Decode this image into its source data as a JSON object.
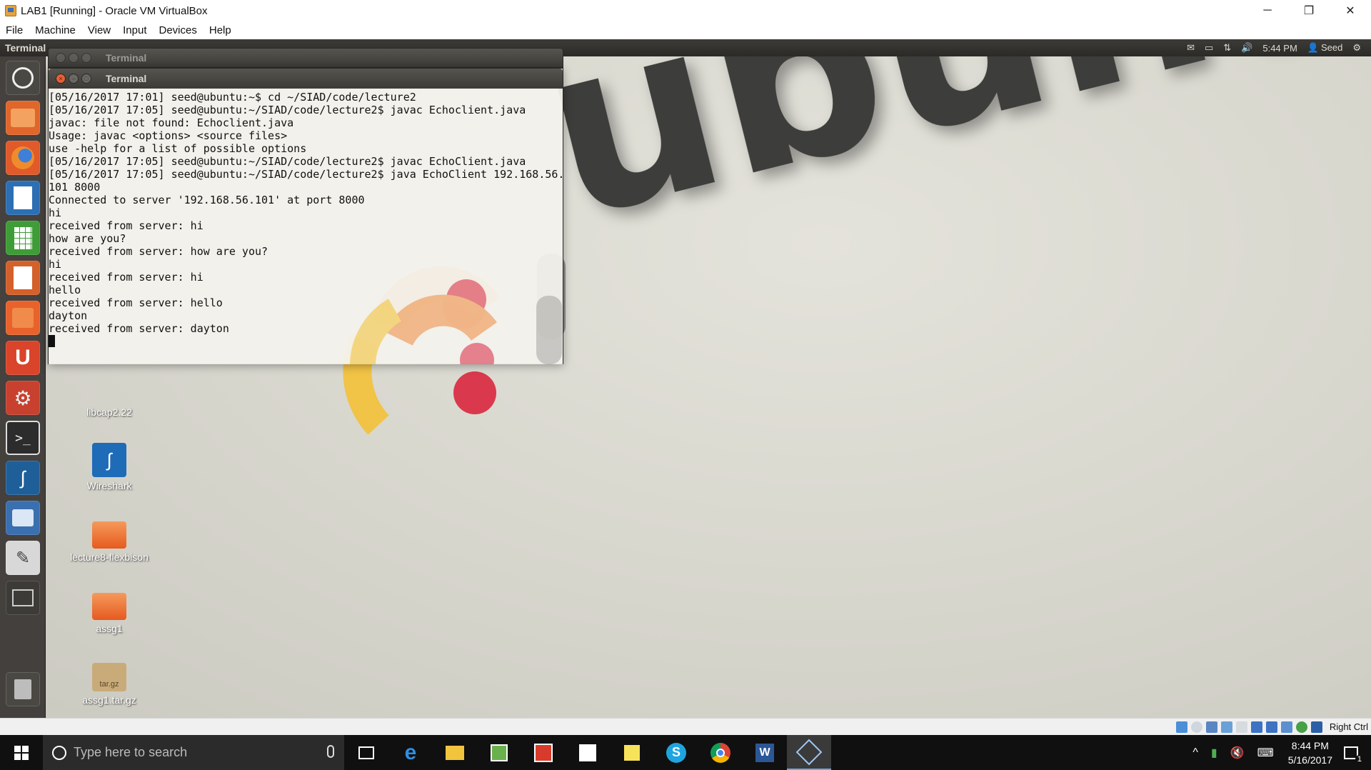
{
  "host_window": {
    "title": "LAB1 [Running] - Oracle VM VirtualBox",
    "controls": {
      "minimize": "─",
      "restore": "❐",
      "close": "✕"
    },
    "menu": [
      "File",
      "Machine",
      "View",
      "Input",
      "Devices",
      "Help"
    ]
  },
  "guest": {
    "topbar": {
      "app_name": "Terminal",
      "time": "5:44 PM",
      "user": "Seed"
    },
    "wallpaper_text": "ubuntu",
    "desktop_icons": [
      {
        "label": "libcap2.22"
      },
      {
        "label": "Wireshark"
      },
      {
        "label": "lecture8-flexbison"
      },
      {
        "label": "assg1"
      },
      {
        "label": "assg1.tar.gz",
        "badge": "tar.gz"
      }
    ],
    "terminal_back": {
      "title": "Terminal"
    },
    "terminal": {
      "title": "Terminal",
      "lines": [
        "[05/16/2017 17:01] seed@ubuntu:~$ cd ~/SIAD/code/lecture2",
        "[05/16/2017 17:05] seed@ubuntu:~/SIAD/code/lecture2$ javac Echoclient.java",
        "javac: file not found: Echoclient.java",
        "Usage: javac <options> <source files>",
        "use -help for a list of possible options",
        "[05/16/2017 17:05] seed@ubuntu:~/SIAD/code/lecture2$ javac EchoClient.java",
        "[05/16/2017 17:05] seed@ubuntu:~/SIAD/code/lecture2$ java EchoClient 192.168.56.",
        "101 8000",
        "Connected to server '192.168.56.101' at port 8000",
        "hi",
        "received from server: hi",
        "how are you?",
        "received from server: how are you?",
        "hi",
        "received from server: hi",
        "hello",
        "received from server: hello",
        "dayton",
        "received from server: dayton"
      ]
    }
  },
  "vbox_status": {
    "host_key": "Right Ctrl"
  },
  "taskbar": {
    "search_placeholder": "Type here to search",
    "time": "8:44 PM",
    "date": "5/16/2017",
    "notification_count": "1"
  },
  "colors": {
    "ubuntu_orange": "#e95420",
    "unity_panel": "#3c3b37",
    "windows_taskbar": "#101010"
  }
}
